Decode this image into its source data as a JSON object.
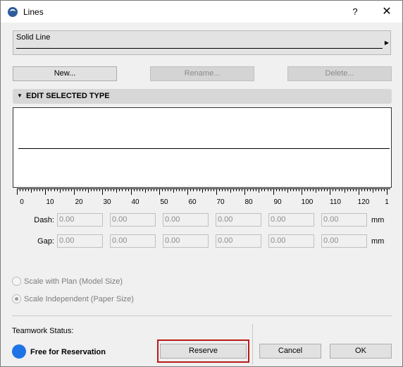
{
  "window": {
    "title": "Lines",
    "help": "?",
    "close": "✕"
  },
  "line_selector": {
    "selected": "Solid Line"
  },
  "buttons": {
    "new": "New...",
    "rename": "Rename...",
    "delete": "Delete..."
  },
  "section": {
    "title": "EDIT SELECTED TYPE"
  },
  "ruler": {
    "labels": [
      "0",
      "10",
      "20",
      "30",
      "40",
      "50",
      "60",
      "70",
      "80",
      "90",
      "100",
      "110",
      "120",
      "1"
    ]
  },
  "dash": {
    "label": "Dash:",
    "values": [
      "0.00",
      "0.00",
      "0.00",
      "0.00",
      "0.00",
      "0.00"
    ],
    "unit": "mm"
  },
  "gap": {
    "label": "Gap:",
    "values": [
      "0.00",
      "0.00",
      "0.00",
      "0.00",
      "0.00",
      "0.00"
    ],
    "unit": "mm"
  },
  "scale": {
    "model": "Scale with Plan (Model Size)",
    "paper": "Scale Independent (Paper Size)",
    "selected": "paper"
  },
  "teamwork": {
    "label": "Teamwork Status:",
    "status": "Free for Reservation",
    "status_color": "#1e74e6"
  },
  "footer": {
    "reserve": "Reserve",
    "cancel": "Cancel",
    "ok": "OK"
  }
}
